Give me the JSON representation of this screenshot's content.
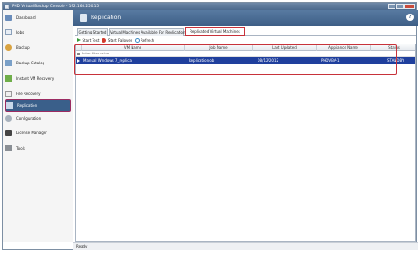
{
  "window": {
    "title": "PHD Virtual Backup Console - 192.168.250.15"
  },
  "sidebar": {
    "items": [
      {
        "label": "Dashboard",
        "icon": "dashboard-icon"
      },
      {
        "label": "Jobs",
        "icon": "jobs-icon"
      },
      {
        "label": "Backup",
        "icon": "backup-icon"
      },
      {
        "label": "Backup Catalog",
        "icon": "catalog-icon"
      },
      {
        "label": "Instant VM Recovery",
        "icon": "instant-recovery-icon"
      },
      {
        "label": "File Recovery",
        "icon": "file-recovery-icon"
      },
      {
        "label": "Replication",
        "icon": "replication-icon"
      },
      {
        "label": "Configuration",
        "icon": "configuration-icon"
      },
      {
        "label": "License Manager",
        "icon": "license-icon"
      },
      {
        "label": "Tools",
        "icon": "tools-icon"
      }
    ]
  },
  "header": {
    "title": "Replication",
    "help": "?"
  },
  "tabs": [
    {
      "label": "Getting Started"
    },
    {
      "label": "Virtual Machines Available For Replication"
    },
    {
      "label": "Replicated Virtual Machines"
    }
  ],
  "toolbar": {
    "start_test": "Start Test",
    "start_failover": "Start Failover",
    "refresh": "Refresh"
  },
  "grid": {
    "columns": [
      "VM Name",
      "Job Name",
      "Last Updated",
      "Appliance Name",
      "Status"
    ],
    "filter_placeholder": "Enter filter value...",
    "rows": [
      {
        "vm_name": "Manual Windows 7_replica",
        "job_name": "ReplicationJob",
        "last_updated": "08/12/2012",
        "appliance_name": "PHDVBA-1",
        "status": "STANDBY"
      }
    ]
  },
  "status": {
    "text": "Ready"
  },
  "colors": {
    "accent": "#3d5e86",
    "selected_row": "#1f3f9d",
    "annotation": "#c8323a"
  }
}
